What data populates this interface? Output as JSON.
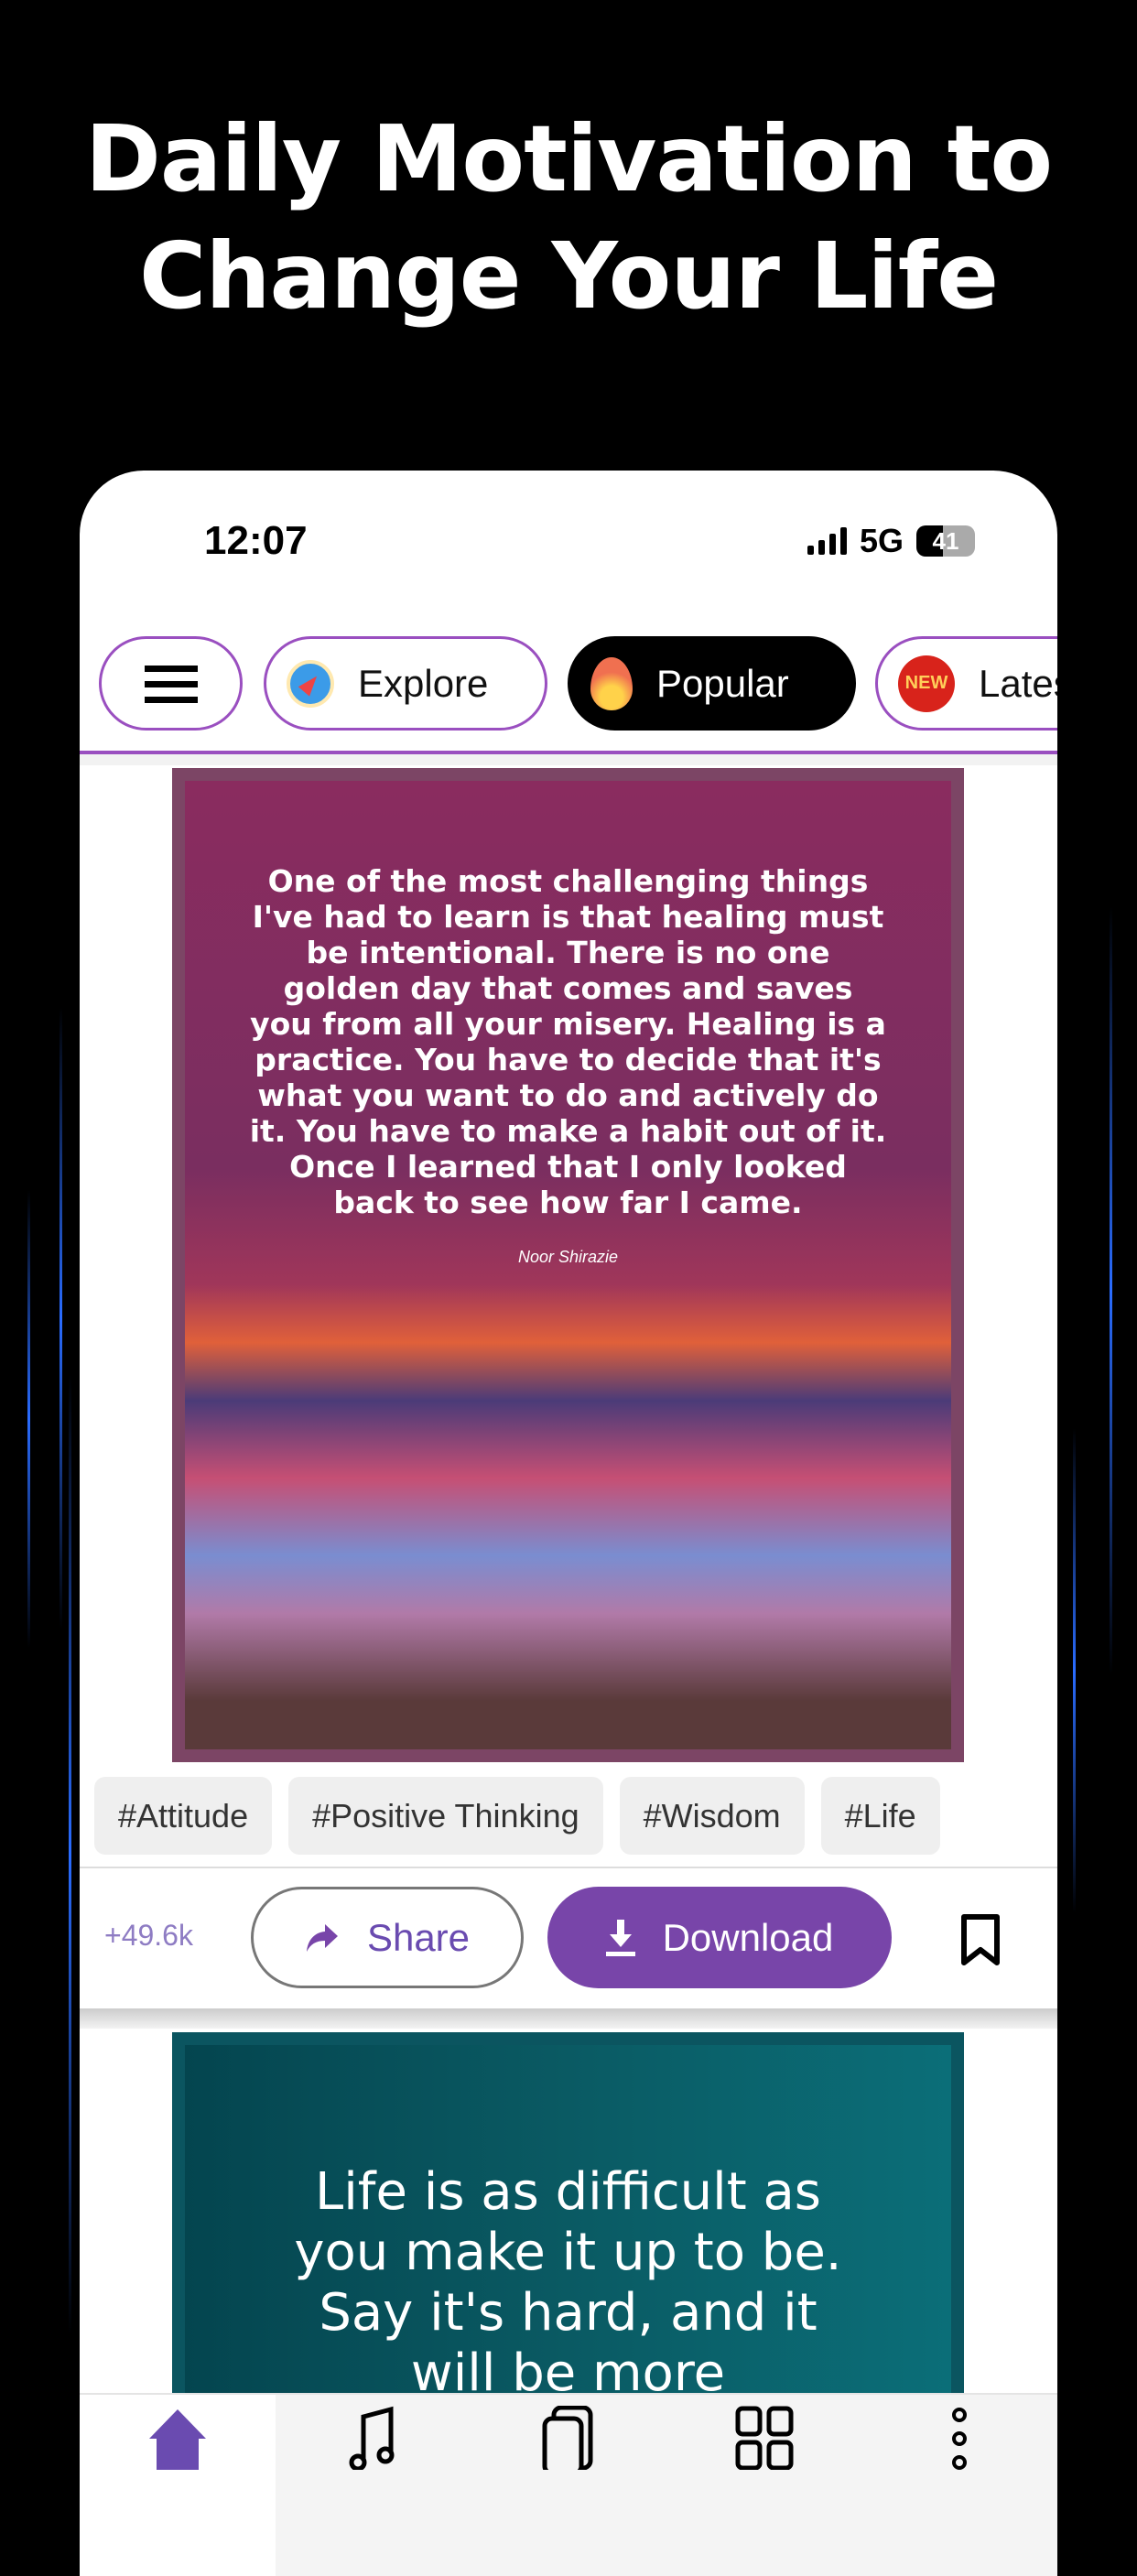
{
  "headline": [
    "Daily Motivation to",
    "Change Your Life"
  ],
  "status": {
    "time": "12:07",
    "network": "5G",
    "battery": "41"
  },
  "tabs": [
    {
      "label": "",
      "icon": "menu-icon"
    },
    {
      "label": "Explore",
      "icon": "compass-icon"
    },
    {
      "label": "Popular",
      "icon": "fire-icon",
      "active": true
    },
    {
      "label": "Latest",
      "icon": "new-badge-icon",
      "badge": "NEW"
    }
  ],
  "post1": {
    "quote": "One of the most challenging things I've had to learn is that healing must be intentional. There is no one golden day that comes and saves you from all your misery. Healing is a practice. You have to decide that it's what you want to do and actively do it. You have to make a habit out of it. Once I learned that I only looked back to see how far I came.",
    "author": "Noor Shirazie",
    "tags": [
      "#Attitude",
      "#Positive Thinking",
      "#Wisdom",
      "#Life"
    ],
    "count": "+49.6k",
    "share_label": "Share",
    "download_label": "Download"
  },
  "post2": {
    "quote": "Life is as difficult as you make it up to be. Say it's hard, and it will be more challenging. Talk"
  },
  "nav": [
    "home-icon",
    "music-icon",
    "bookmarks-icon",
    "grid-icon",
    "more-icon"
  ],
  "colors": {
    "accent": "#7845a9",
    "tab_border": "#9a4fc0"
  }
}
